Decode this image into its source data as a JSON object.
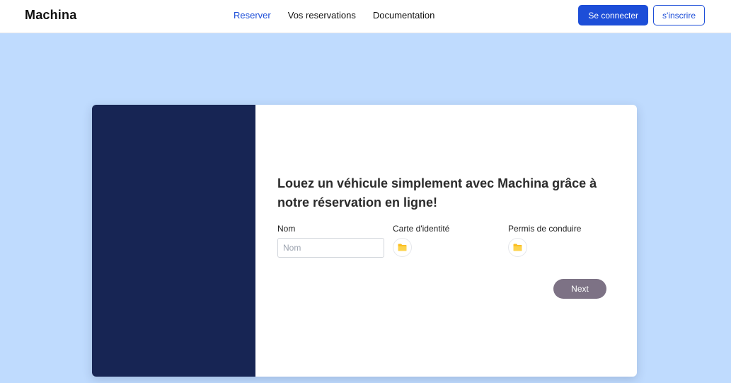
{
  "navbar": {
    "brand": "Machina",
    "links": [
      {
        "label": "Reserver",
        "active": true
      },
      {
        "label": "Vos reservations",
        "active": false
      },
      {
        "label": "Documentation",
        "active": false
      }
    ],
    "login_label": "Se connecter",
    "signup_label": "s'inscrire"
  },
  "form": {
    "heading": "Louez un véhicule simplement avec Machina grâce à notre réservation en ligne!",
    "name_label": "Nom",
    "name_placeholder": "Nom",
    "name_value": "",
    "id_card_label": "Carte d'identité",
    "license_label": "Permis de conduire",
    "next_label": "Next"
  },
  "icons": {
    "file_picker": "folder-icon"
  },
  "colors": {
    "accent": "#1d4ed8",
    "page_background": "#bfdbfe",
    "side_panel": "#172554",
    "next_button": "#7d7285",
    "folder_icon": "#fbbf24"
  }
}
